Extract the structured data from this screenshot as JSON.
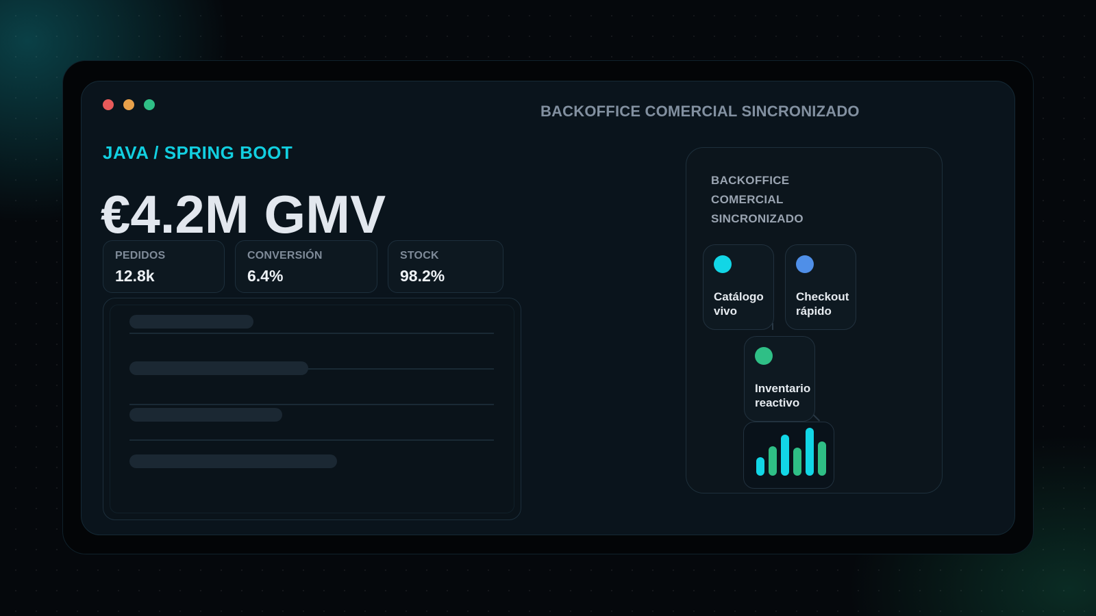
{
  "window": {
    "header_title": "BACKOFFICE COMERCIAL SINCRONIZADO",
    "controls": [
      "close",
      "minimize",
      "maximize"
    ]
  },
  "hero": {
    "kicker": "JAVA / SPRING BOOT",
    "headline": "€4.2M GMV"
  },
  "stats": [
    {
      "label": "PEDIDOS",
      "value": "12.8k"
    },
    {
      "label": "CONVERSIÓN",
      "value": "6.4%"
    },
    {
      "label": "STOCK",
      "value": "98.2%"
    }
  ],
  "list_panel": {
    "skeleton_rows": [
      {
        "fill": 0.34
      },
      {
        "fill": 0.49
      },
      {
        "fill": 0.42
      },
      {
        "fill": 0.57
      }
    ]
  },
  "side_panel": {
    "title_lines": [
      "BACKOFFICE",
      "COMERCIAL",
      "SINCRONIZADO"
    ],
    "nodes": [
      {
        "label_lines": [
          "Catálogo",
          "vivo"
        ],
        "color": "#12d6e6",
        "icon": "status-dot-icon"
      },
      {
        "label_lines": [
          "Checkout",
          "rápido"
        ],
        "color": "#4f8fe8",
        "icon": "status-dot-icon"
      },
      {
        "label_lines": [
          "Inventario",
          "reactivo"
        ],
        "color": "#2fbf86",
        "icon": "status-dot-icon"
      }
    ],
    "mini_chart": {
      "values": [
        0.38,
        0.62,
        0.85,
        0.58,
        1.0,
        0.72
      ],
      "colors": [
        "#12d6e6",
        "#2fbf86",
        "#12d6e6",
        "#2fbf86",
        "#12d6e6",
        "#2fbf86"
      ]
    }
  },
  "colors": {
    "accent": "#12cfe0",
    "close": "#e85a5a",
    "minimize": "#e8a14a",
    "maximize": "#2fbf86"
  }
}
